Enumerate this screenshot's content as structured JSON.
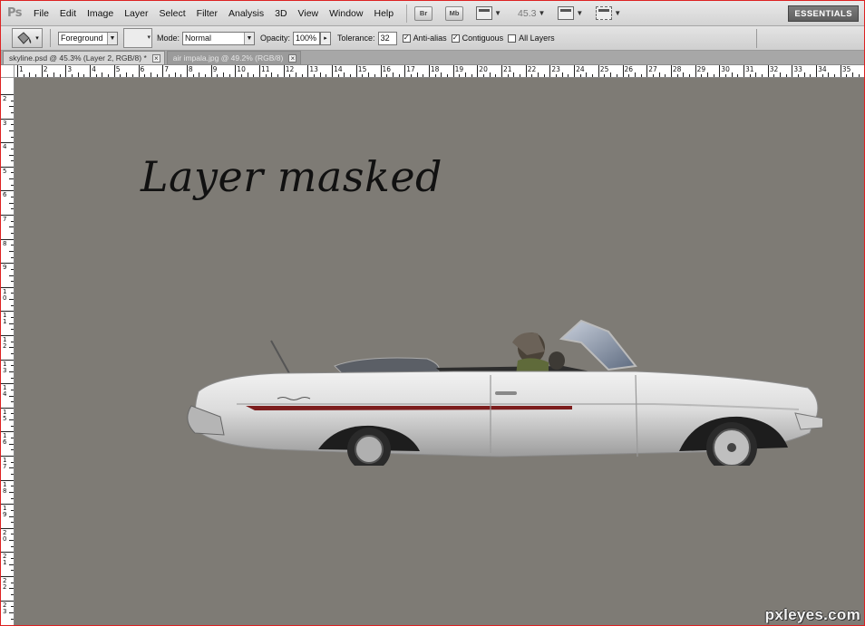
{
  "app": {
    "logo_text": "Ps",
    "menu": [
      "File",
      "Edit",
      "Image",
      "Layer",
      "Select",
      "Filter",
      "Analysis",
      "3D",
      "View",
      "Window",
      "Help"
    ],
    "bridge_button": "Br",
    "minibridge_button": "Mb",
    "zoom_level": "45.3",
    "workspace_button": "ESSENTIALS"
  },
  "options_bar": {
    "fill_source": "Foreground",
    "mode_label": "Mode:",
    "mode_value": "Normal",
    "opacity_label": "Opacity:",
    "opacity_value": "100%",
    "tolerance_label": "Tolerance:",
    "tolerance_value": "32",
    "anti_alias_label": "Anti-alias",
    "anti_alias_checked": true,
    "contiguous_label": "Contiguous",
    "contiguous_checked": true,
    "all_layers_label": "All Layers",
    "all_layers_checked": false,
    "icons": [
      "paint-bucket-icon"
    ]
  },
  "tabs": [
    {
      "label": "skyline.psd @ 45.3% (Layer 2, RGB/8) *",
      "active": true
    },
    {
      "label": "air impala.jpg @ 49.2% (RGB/8)",
      "active": false
    }
  ],
  "rulers": {
    "top_labels": [
      "1",
      "2",
      "3",
      "4",
      "5",
      "6",
      "7",
      "8",
      "9",
      "10",
      "11",
      "12",
      "13",
      "14",
      "15",
      "16",
      "17",
      "18",
      "19",
      "20",
      "21",
      "22",
      "23",
      "24",
      "25",
      "26",
      "27",
      "28",
      "29",
      "30",
      "31",
      "32",
      "33",
      "34",
      "35"
    ],
    "left_labels": [
      "2",
      "3",
      "4",
      "5",
      "6",
      "7",
      "8",
      "9",
      "10",
      "11",
      "12",
      "13",
      "14",
      "15",
      "16",
      "17",
      "18",
      "19",
      "20",
      "21",
      "22",
      "23"
    ]
  },
  "canvas": {
    "background_color": "#7e7b75",
    "annotation": "Layer masked",
    "watermark": "pxleyes.com"
  }
}
